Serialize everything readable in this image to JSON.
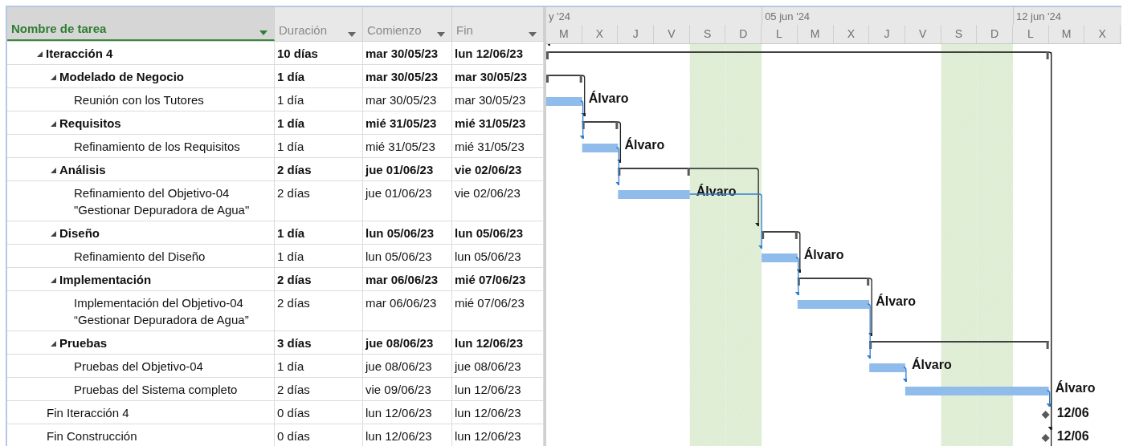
{
  "columns": [
    {
      "label": "Nombre de tarea",
      "selected": true
    },
    {
      "label": "Duración",
      "selected": false
    },
    {
      "label": "Comienzo",
      "selected": false
    },
    {
      "label": "Fin",
      "selected": false
    }
  ],
  "timeline": {
    "days": [
      {
        "label": "M",
        "kind": "workday",
        "week": "y '24"
      },
      {
        "label": "X",
        "kind": "workday"
      },
      {
        "label": "J",
        "kind": "workday"
      },
      {
        "label": "V",
        "kind": "workday"
      },
      {
        "label": "S",
        "kind": "weekend"
      },
      {
        "label": "D",
        "kind": "weekend"
      },
      {
        "label": "L",
        "kind": "workday",
        "week": "05 jun '24"
      },
      {
        "label": "M",
        "kind": "workday"
      },
      {
        "label": "X",
        "kind": "workday"
      },
      {
        "label": "J",
        "kind": "workday"
      },
      {
        "label": "V",
        "kind": "workday"
      },
      {
        "label": "S",
        "kind": "weekend"
      },
      {
        "label": "D",
        "kind": "weekend"
      },
      {
        "label": "L",
        "kind": "workday",
        "week": "12 jun '24"
      },
      {
        "label": "M",
        "kind": "workday"
      },
      {
        "label": "X",
        "kind": "workday"
      }
    ]
  },
  "tasks": [
    {
      "name": "Iteracción 4",
      "kind": "summary",
      "expanded": true,
      "duration": "10 días",
      "start": "mar 30/05/23",
      "finish": "lun 12/06/23",
      "children": [
        {
          "name": "Modelado de Negocio",
          "kind": "summary",
          "expanded": true,
          "duration": "1 día",
          "start": "mar 30/05/23",
          "finish": "mar 30/05/23",
          "children": [
            {
              "name": "Reunión con los Tutores",
              "kind": "task",
              "duration": "1 día",
              "start": "mar 30/05/23",
              "finish": "mar 30/05/23",
              "resource": "Álvaro"
            }
          ]
        },
        {
          "name": "Requisitos",
          "kind": "summary",
          "expanded": true,
          "duration": "1 día",
          "start": "mié 31/05/23",
          "finish": "mié 31/05/23",
          "children": [
            {
              "name": "Refinamiento de los Requisitos",
              "kind": "task",
              "duration": "1 día",
              "start": "mié 31/05/23",
              "finish": "mié 31/05/23",
              "resource": "Álvaro"
            }
          ]
        },
        {
          "name": "Análisis",
          "kind": "summary",
          "expanded": true,
          "duration": "2 días",
          "start": "jue 01/06/23",
          "finish": "vie 02/06/23",
          "children": [
            {
              "name": "Refinamiento del Objetivo-04\n\"Gestionar Depuradora de Agua\"",
              "kind": "task",
              "duration": "2 días",
              "start": "jue 01/06/23",
              "finish": "vie 02/06/23",
              "resource": "Álvaro"
            }
          ]
        },
        {
          "name": "Diseño",
          "kind": "summary",
          "expanded": true,
          "duration": "1 día",
          "start": "lun 05/06/23",
          "finish": "lun 05/06/23",
          "children": [
            {
              "name": "Refinamiento del Diseño",
              "kind": "task",
              "duration": "1 día",
              "start": "lun 05/06/23",
              "finish": "lun 05/06/23",
              "resource": "Álvaro"
            }
          ]
        },
        {
          "name": "Implementación",
          "kind": "summary",
          "expanded": true,
          "duration": "2 días",
          "start": "mar 06/06/23",
          "finish": "mié 07/06/23",
          "children": [
            {
              "name": "Implementación del Objetivo-04\n“Gestionar Depuradora de Agua”",
              "kind": "task",
              "duration": "2 días",
              "start": "mar 06/06/23",
              "finish": "mié 07/06/23",
              "resource": "Álvaro"
            }
          ]
        },
        {
          "name": "Pruebas",
          "kind": "summary",
          "expanded": true,
          "duration": "3 días",
          "start": "jue 08/06/23",
          "finish": "lun 12/06/23",
          "children": [
            {
              "name": "Pruebas del Objetivo-04",
              "kind": "task",
              "duration": "1 día",
              "start": "jue 08/06/23",
              "finish": "jue 08/06/23",
              "resource": "Álvaro"
            },
            {
              "name": "Pruebas del Sistema completo",
              "kind": "task",
              "duration": "2 días",
              "start": "vie 09/06/23",
              "finish": "lun 12/06/23",
              "resource": "Álvaro"
            }
          ]
        }
      ]
    },
    {
      "name": "Fin Iteracción 4",
      "kind": "milestone",
      "duration": "0 días",
      "start": "lun 12/06/23",
      "finish": "lun 12/06/23",
      "label": "12/06"
    },
    {
      "name": "Fin Construcción",
      "kind": "milestone",
      "duration": "0 días",
      "start": "lun 12/06/23",
      "finish": "lun 12/06/23",
      "label": "12/06"
    }
  ]
}
